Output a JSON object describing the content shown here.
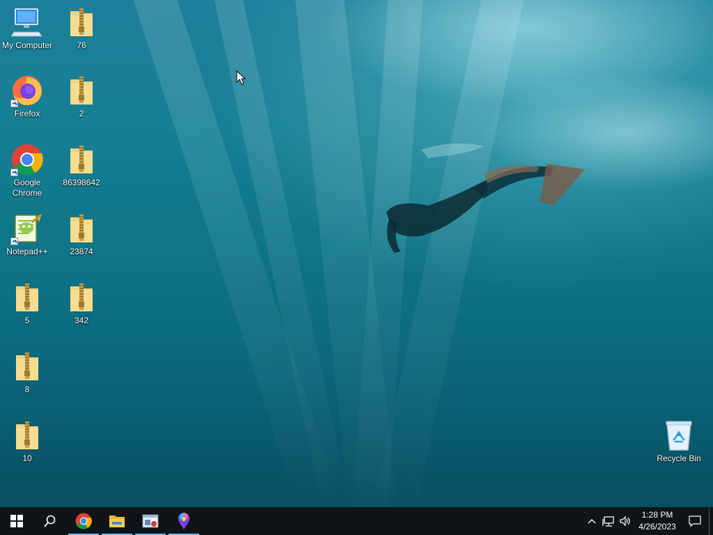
{
  "desktop": {
    "wallpaper": "underwater-diver",
    "icons": [
      {
        "label": "My Computer",
        "icon": "computer-icon"
      },
      {
        "label": "76",
        "icon": "zip-folder-icon"
      },
      {
        "label": "Firefox",
        "icon": "firefox-icon"
      },
      {
        "label": "2",
        "icon": "zip-folder-icon"
      },
      {
        "label": "Google Chrome",
        "icon": "chrome-icon"
      },
      {
        "label": "86398642",
        "icon": "zip-folder-icon"
      },
      {
        "label": "Notepad++",
        "icon": "notepadpp-icon"
      },
      {
        "label": "23874",
        "icon": "zip-folder-icon"
      },
      {
        "label": "5",
        "icon": "zip-folder-icon"
      },
      {
        "label": "342",
        "icon": "zip-folder-icon"
      },
      {
        "label": "8",
        "icon": "zip-folder-icon"
      },
      {
        "label": "10",
        "icon": "zip-folder-icon"
      },
      {
        "label": "Recycle Bin",
        "icon": "recycle-bin-icon"
      }
    ]
  },
  "taskbar": {
    "buttons": [
      {
        "name": "start",
        "icon": "windows-logo-icon"
      },
      {
        "name": "search",
        "icon": "search-icon"
      },
      {
        "name": "chrome",
        "icon": "chrome-icon"
      },
      {
        "name": "file-explorer",
        "icon": "folder-icon"
      },
      {
        "name": "app",
        "icon": "window-app-icon"
      },
      {
        "name": "paint",
        "icon": "paint-icon"
      }
    ],
    "tray": {
      "icons": [
        "chevron-up-icon",
        "network-icon",
        "volume-icon",
        "notification-icon"
      ],
      "time": "1:28 PM",
      "date": "4/26/2023"
    }
  }
}
